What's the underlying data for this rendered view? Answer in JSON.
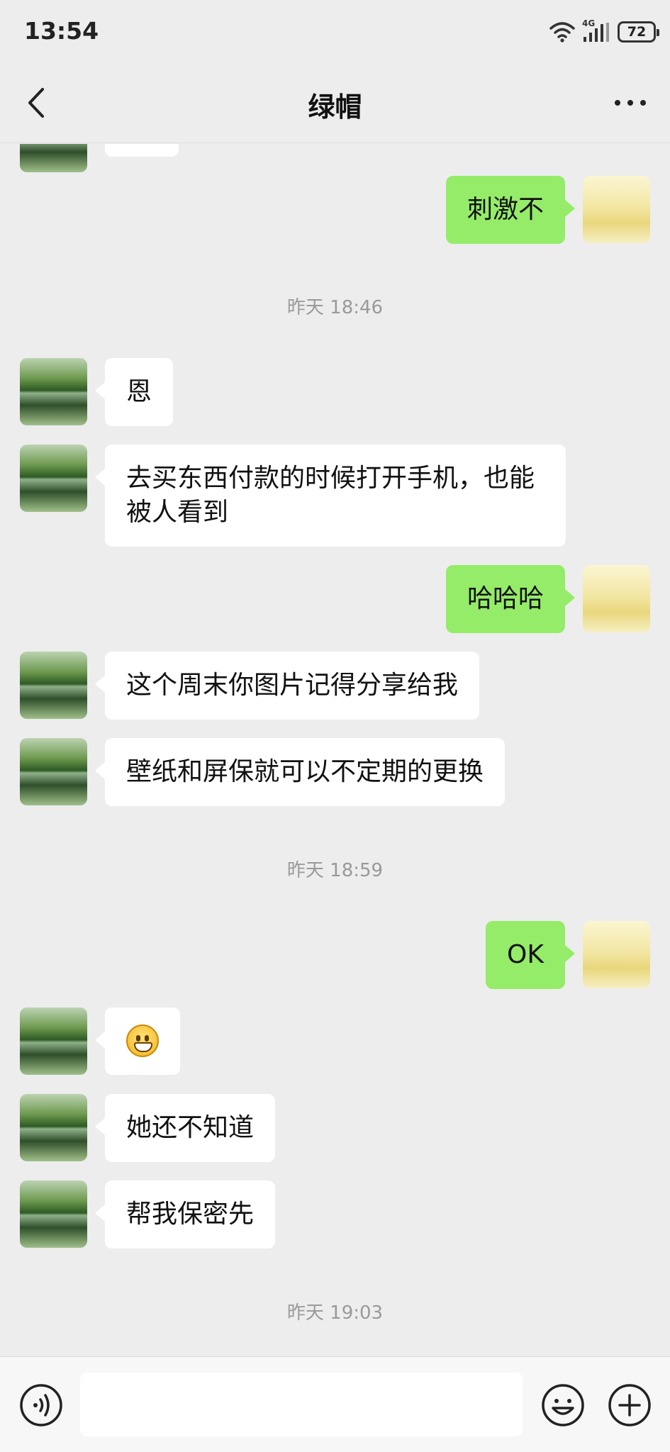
{
  "status": {
    "time": "13:54",
    "network": "4G",
    "battery": "72"
  },
  "header": {
    "title": "绿帽"
  },
  "colors": {
    "my_bubble": "#95ec69",
    "their_bubble": "#ffffff",
    "background": "#ededed",
    "timestamp": "#9a9a9a"
  },
  "messages": [
    {
      "sender": "mine",
      "text": "刺激不"
    },
    {
      "type": "timestamp",
      "text": "昨天 18:46"
    },
    {
      "sender": "other",
      "text": "恩"
    },
    {
      "sender": "other",
      "text": "去买东西付款的时候打开手机，也能被人看到"
    },
    {
      "sender": "mine",
      "text": "哈哈哈"
    },
    {
      "sender": "other",
      "text": "这个周末你图片记得分享给我"
    },
    {
      "sender": "other",
      "text": "壁纸和屏保就可以不定期的更换"
    },
    {
      "type": "timestamp",
      "text": "昨天 18:59"
    },
    {
      "sender": "mine",
      "text": "OK"
    },
    {
      "sender": "other",
      "emoji": "grinning-face"
    },
    {
      "sender": "other",
      "text": "她还不知道"
    },
    {
      "sender": "other",
      "text": "帮我保密先"
    },
    {
      "type": "timestamp",
      "text": "昨天 19:03"
    }
  ],
  "input": {
    "value": "",
    "placeholder": ""
  },
  "icons": {
    "back": "chevron-left-icon",
    "more": "more-dots-icon",
    "voice": "voice-icon",
    "emoji": "emoji-icon",
    "plus": "plus-icon"
  }
}
